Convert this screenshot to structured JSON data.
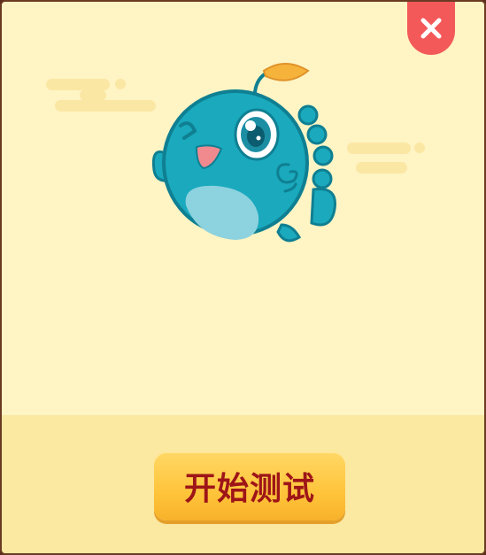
{
  "dialog": {
    "close_icon": "close-x-icon",
    "mascot": "pufferfish-mascot-winking",
    "start_button_label": "开始测试"
  },
  "colors": {
    "background_top": "#fef4c4",
    "background_bottom": "#fbe8a1",
    "close_button": "#f4595a",
    "button_fill": "#ffc43a",
    "button_text": "#9e1518",
    "fish_body": "#1aa9bd"
  }
}
